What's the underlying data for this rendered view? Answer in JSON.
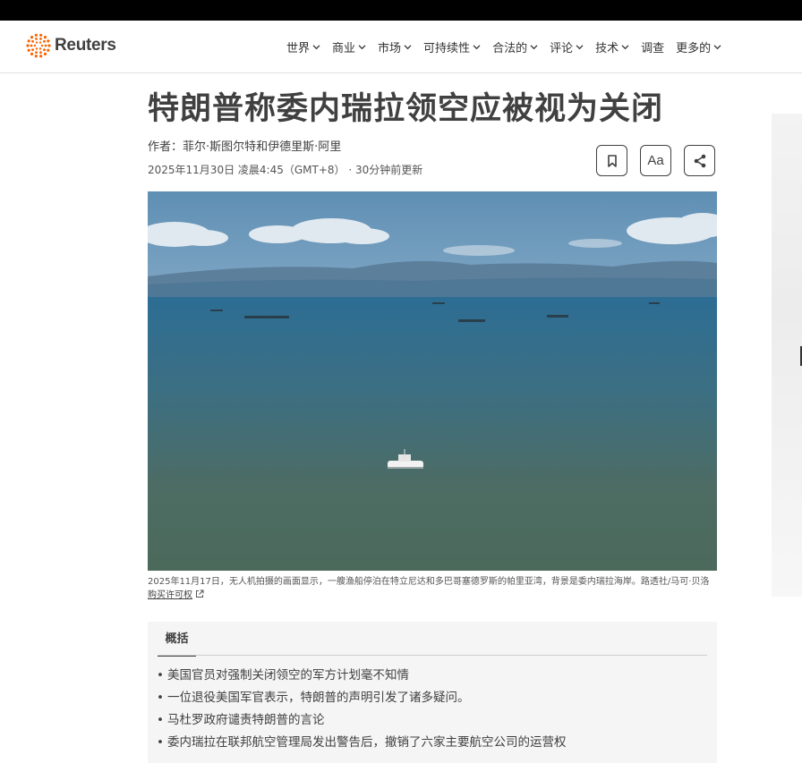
{
  "brand": {
    "name": "Reuters"
  },
  "nav": {
    "items": [
      {
        "label": "世界",
        "chevron": true
      },
      {
        "label": "商业",
        "chevron": true
      },
      {
        "label": "市场",
        "chevron": true
      },
      {
        "label": "可持续性",
        "chevron": true
      },
      {
        "label": "合法的",
        "chevron": true
      },
      {
        "label": "评论",
        "chevron": true
      },
      {
        "label": "技术",
        "chevron": true
      },
      {
        "label": "调查",
        "chevron": false
      },
      {
        "label": "更多的",
        "chevron": true
      }
    ]
  },
  "article": {
    "title": "特朗普称委内瑞拉领空应被视为关闭",
    "byline_prefix": "作者：",
    "authors": "菲尔·斯图尔特和伊德里斯·阿里",
    "date": "2025年11月30日 凌晨4:45（GMT+8）",
    "updated": " · 30分钟前更新",
    "tools": {
      "font_size_label": "Aa"
    },
    "image_caption": "2025年11月17日，无人机拍摄的画面显示，一艘渔船停泊在特立尼达和多巴哥塞德罗斯的帕里亚湾，背景是委内瑞拉海岸。路透社/马可·贝洛",
    "image_license_link": "购买许可权"
  },
  "summary": {
    "tab_label": "概括",
    "points": [
      "美国官员对强制关闭领空的军方计划毫不知情",
      "一位退役美国军官表示，特朗普的声明引发了诸多疑问。",
      "马杜罗政府谴责特朗普的言论",
      "委内瑞拉在联邦航空管理局发出警告后，撤销了六家主要航空公司的运营权"
    ]
  },
  "icons": {
    "logo": "reuters-dots-logo",
    "bookmark": "bookmark-icon",
    "share": "share-icon",
    "chevron": "chevron-down-icon",
    "external": "external-link-icon"
  },
  "colors": {
    "text": "#404040",
    "accent": "#fa6400",
    "summary_bg": "#f5f5f5"
  }
}
